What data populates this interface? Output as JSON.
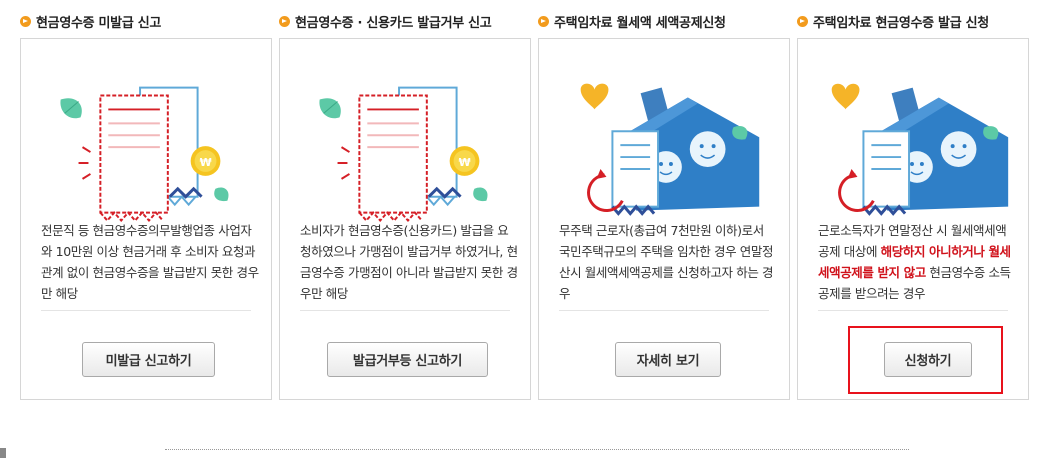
{
  "sections": [
    {
      "title": "현금영수증 미발급 신고",
      "desc": [
        "전문직 등 현금영수증의무발행업종 사업자와 10만원 이상 현금거래 후 소비자 요청과 관계 없이 현금영수증을 발급받지 못한 경우만 해당"
      ],
      "button": "미발급 신고하기"
    },
    {
      "title": "현금영수증 · 신용카드 발급거부 신고",
      "desc": [
        "소비자가 현금영수증(신용카드) 발급을 요청하였으나 가맹점이 발급거부 하였거나, 현금영수증 가맹점이 아니라 발급받지 못한 경우만 해당"
      ],
      "button": "발급거부등 신고하기"
    },
    {
      "title": "주택임차료 월세액 세액공제신청",
      "desc": [
        "무주택 근로자(총급여 7천만원 이하)로서 국민주택규모의 주택을 임차한 경우 연말정산시 월세액세액공제를 신청하고자 하는 경우"
      ],
      "button": "자세히 보기"
    },
    {
      "title": "주택임차료 현금영수증 발급 신청",
      "desc_before": "근로소득자가 연말정산 시 월세액세액공제 대상에 ",
      "desc_red": "해당하지 아니하거나 월세세액공제를 받지 않고",
      "desc_after": " 현금영수증 소득공제를 받으려는 경우",
      "button": "신청하기"
    }
  ],
  "icons": {
    "section_bullet": "orange-arrow-bullet-icon",
    "card1": "torn-receipt-leaf-icon",
    "card2": "torn-receipt-leaf-icon",
    "card3": "house-receipt-refresh-icon",
    "card4": "house-receipt-refresh-icon"
  },
  "colors": {
    "accent_orange": "#f29b1d",
    "highlight_red": "#e8121c",
    "desc_red": "#d0121b",
    "illus_blue": "#2f7fc7",
    "illus_leaf": "#5cc9a6",
    "illus_heart": "#f5b428"
  }
}
